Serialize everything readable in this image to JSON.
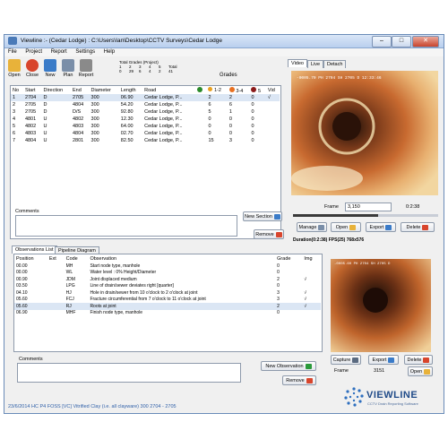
{
  "window": {
    "title": "Viewline :- (Cedar Lodge) : C:\\Users\\Ian\\Desktop\\CCTV Surveys\\Cedar Lodge",
    "controls": {
      "minimize": "–",
      "maximize": "□",
      "close": "✕"
    }
  },
  "menu": [
    "File",
    "Project",
    "Report",
    "Settings",
    "Help"
  ],
  "toolbar": [
    {
      "label": "Open",
      "icon": "folder-icon",
      "color": "#e8b23a"
    },
    {
      "label": "Close",
      "icon": "close-circle-icon",
      "color": "#d8452c"
    },
    {
      "label": "New",
      "icon": "new-document-icon",
      "color": "#3a7bc8"
    },
    {
      "label": "Plan",
      "icon": "plan-icon",
      "color": "#7a8ea8"
    },
    {
      "label": "Report",
      "icon": "report-icon",
      "color": "#8a8a8a"
    }
  ],
  "totals": {
    "title": "Total Grades (Project)",
    "headers": [
      "1",
      "2",
      "3",
      "4",
      "5",
      "Total"
    ],
    "values": [
      "0",
      "29",
      "6",
      "4",
      "2",
      "41"
    ],
    "grades_label": "Grades"
  },
  "sections": {
    "headers": {
      "no": "No",
      "start": "Start",
      "direction": "Direction",
      "end": "End",
      "diameter": "Diameter",
      "length": "Length",
      "road": "Road",
      "g12": "1-2",
      "g34": "3-4",
      "g5": "5",
      "vid": "Vid"
    },
    "grade_colors": {
      "g1": "#2a8a2a",
      "g12": "#e8a020",
      "g34": "#e87020",
      "g5": "#8a1a1a"
    },
    "rows": [
      {
        "no": "1",
        "start": "2704",
        "direction": "D",
        "end": "2705",
        "diameter": "300",
        "length": "06.90",
        "road": "Cedar Lodge, P...",
        "g12": "2",
        "g34": "2",
        "g5": "0",
        "vid": "√"
      },
      {
        "no": "2",
        "start": "2705",
        "direction": "D",
        "end": "4804",
        "diameter": "300",
        "length": "54.20",
        "road": "Cedar Lodge, P...",
        "g12": "6",
        "g34": "6",
        "g5": "0",
        "vid": ""
      },
      {
        "no": "3",
        "start": "2705",
        "direction": "D",
        "end": "D/S",
        "diameter": "300",
        "length": "92.80",
        "road": "Cedar Lodge, P...",
        "g12": "5",
        "g34": "1",
        "g5": "0",
        "vid": ""
      },
      {
        "no": "4",
        "start": "4801",
        "direction": "U",
        "end": "4802",
        "diameter": "300",
        "length": "12.30",
        "road": "Cedar Lodge, P...",
        "g12": "0",
        "g34": "0",
        "g5": "0",
        "vid": ""
      },
      {
        "no": "5",
        "start": "4802",
        "direction": "U",
        "end": "4803",
        "diameter": "300",
        "length": "64.00",
        "road": "Cedar Lodge, P...",
        "g12": "0",
        "g34": "0",
        "g5": "0",
        "vid": ""
      },
      {
        "no": "6",
        "start": "4803",
        "direction": "U",
        "end": "4804",
        "diameter": "300",
        "length": "02.70",
        "road": "Cedar Lodge, P...",
        "g12": "0",
        "g34": "0",
        "g5": "0",
        "vid": ""
      },
      {
        "no": "7",
        "start": "4804",
        "direction": "U",
        "end": "2801",
        "diameter": "300",
        "length": "82.50",
        "road": "Cedar Lodge, P...",
        "g12": "15",
        "g34": "3",
        "g5": "0",
        "vid": ""
      }
    ]
  },
  "comments_label": "Comments",
  "new_section_label": "New Section",
  "remove_label": "Remove",
  "video_tabs": [
    "Video",
    "Live",
    "Detach"
  ],
  "video": {
    "overlay_text": "-0005.70  PH 2704 SH 2705 D  12:33:46",
    "frame_label": "Frame",
    "frame_value": "3,150",
    "time_value": "0:2:38",
    "manage": "Manage",
    "open": "Open",
    "export": "Export",
    "delete": "Delete",
    "duration": "Duration(0:2:38)  FPS(25)  768x576"
  },
  "obs_tabs": [
    "Observations List",
    "Pipeline Diagram"
  ],
  "observations": {
    "headers": {
      "position": "Position",
      "ext": "Ext",
      "code": "Code",
      "observation": "Observation",
      "grade": "Grade",
      "img": "Img"
    },
    "rows": [
      {
        "position": "00.00",
        "ext": "",
        "code": "MH",
        "observation": "Start node type, manhole",
        "grade": "0",
        "img": ""
      },
      {
        "position": "00.00",
        "ext": "",
        "code": "WL",
        "observation": "Water level   : 0% Height/Diameter",
        "grade": "0",
        "img": ""
      },
      {
        "position": "00.90",
        "ext": "",
        "code": "JDM",
        "observation": "Joint displaced medium",
        "grade": "2",
        "img": "√"
      },
      {
        "position": "03.50",
        "ext": "",
        "code": "LPG",
        "observation": "Line of drain/sewer deviates right [quarter]",
        "grade": "0",
        "img": ""
      },
      {
        "position": "04.10",
        "ext": "",
        "code": "HJ",
        "observation": "Hole in drain/sewer  from 10 o'clock to 2 o'clock at joint",
        "grade": "3",
        "img": "√"
      },
      {
        "position": "05.60",
        "ext": "",
        "code": "FCJ",
        "observation": "Fracture circumferential  from 7 o'clock to 11 o'clock at joint",
        "grade": "3",
        "img": "√"
      },
      {
        "position": "05.60",
        "ext": "",
        "code": "RJ",
        "observation": "Roots  at joint",
        "grade": "2",
        "img": "√"
      },
      {
        "position": "06.90",
        "ext": "",
        "code": "MHF",
        "observation": "Finish node type, manhole",
        "grade": "0",
        "img": ""
      }
    ]
  },
  "new_observation_label": "New Observation",
  "still": {
    "overlay_text": "-0005.60  PH 2704 SH 2705 D",
    "capture": "Capture",
    "export": "Export",
    "delete": "Delete",
    "open": "Open",
    "frame_label": "Frame",
    "frame_value": "3151"
  },
  "status": {
    "text": "23/6/2014  HC  P4 FOSS  [VC] Vitrified Clay (i.e. all clayware)  300  2704 - 2705"
  },
  "logo": {
    "name": "VIEWLINE",
    "tagline": "CCTV Drain Reporting Software"
  }
}
